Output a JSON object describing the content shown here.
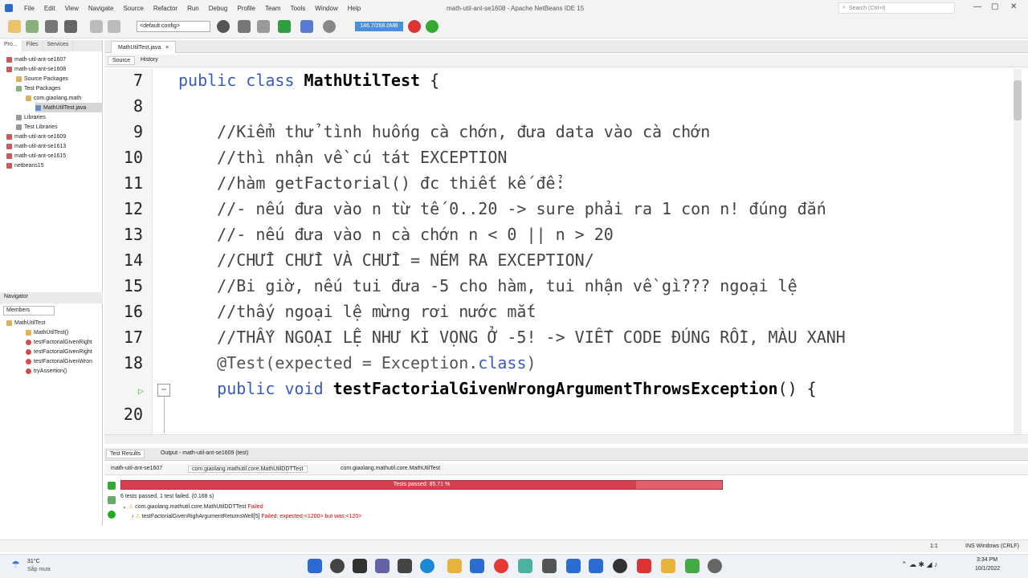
{
  "window_title": "math-util-ant-se1608 - Apache NetBeans IDE 15",
  "menu": [
    "File",
    "Edit",
    "View",
    "Navigate",
    "Source",
    "Refactor",
    "Run",
    "Debug",
    "Profile",
    "Team",
    "Tools",
    "Window",
    "Help"
  ],
  "search_placeholder": "Search (Ctrl+I)",
  "toolbar": {
    "config": "<default config>",
    "memory": "146.7/268.0MB"
  },
  "left_panel": {
    "tabs": [
      "Pro...",
      "Files",
      "Services"
    ],
    "tree": [
      "math-util-ant-se1607",
      "math-util-ant-se1608",
      "Source Packages",
      "Test Packages",
      "com.giaolang.math",
      "MathUtilTest.java",
      "Libraries",
      "Test Libraries",
      "math-util-ant-se1609",
      "math-util-ant-se1613",
      "math-util-ant-se1615",
      "netbeans15"
    ]
  },
  "navigator": {
    "title": "Navigator",
    "filter": "Members",
    "root": "MathUtilTest",
    "members": [
      "MathUtilTest()",
      "testFactorialGivenRight",
      "testFactorialGivenRight",
      "testFactorialGivenWron",
      "tryAssertion()"
    ]
  },
  "editor": {
    "tab": "MathUtilTest.java",
    "subtabs": [
      "Source",
      "History"
    ],
    "lines": [
      {
        "no": "7",
        "parts": [
          [
            "kw2",
            "public class "
          ],
          [
            "cls",
            "MathUtilTest"
          ],
          [
            "",
            " {"
          ]
        ]
      },
      {
        "no": "8",
        "parts": []
      },
      {
        "no": "9",
        "parts": [
          [
            "cmt",
            "    //Kiểm thử tình huống cà chớn, đưa data vào cà chớn"
          ]
        ]
      },
      {
        "no": "10",
        "parts": [
          [
            "cmt",
            "    //thì nhận về cú tát EXCEPTION"
          ]
        ]
      },
      {
        "no": "11",
        "parts": [
          [
            "cmt",
            "    //hàm getFactorial() đc thiết kế để:"
          ]
        ]
      },
      {
        "no": "12",
        "parts": [
          [
            "cmt",
            "    //- nếu đưa vào n từ tế 0..20 -> sure phải ra 1 con n! đúng đắn"
          ]
        ]
      },
      {
        "no": "13",
        "parts": [
          [
            "cmt",
            "    //- nếu đưa vào n cà chớn n < 0 || n > 20"
          ]
        ]
      },
      {
        "no": "14",
        "parts": [
          [
            "cmt",
            "    //CHỬI CHỬI VÀ CHỬI = NÉM RA EXCEPTION/"
          ]
        ]
      },
      {
        "no": "15",
        "parts": [
          [
            "cmt",
            "    //Bi giờ, nếu tui đưa -5 cho hàm, tui nhận về gì??? ngoại lệ"
          ]
        ]
      },
      {
        "no": "16",
        "parts": [
          [
            "cmt",
            "    //thấy ngoại lệ mừng rơi nước mắt"
          ]
        ]
      },
      {
        "no": "17",
        "parts": [
          [
            "cmt",
            "    //THẤY NGOẠI LỆ NHƯ KÌ VỌNG Ở -5! -> VIẾT CODE ĐÚNG RỒI, MÀU XANH"
          ]
        ]
      },
      {
        "no": "18",
        "parts": [
          [
            "ann",
            "    @Test(expected = Exception."
          ],
          [
            "kw2",
            "class"
          ],
          [
            "ann",
            ")"
          ]
        ]
      },
      {
        "no": "",
        "parts": [
          [
            "kw2",
            "    public void "
          ],
          [
            "cls",
            "testFactorialGivenWrongArgumentThrowsException"
          ],
          [
            "",
            "() {"
          ]
        ]
      },
      {
        "no": "20",
        "parts": []
      }
    ]
  },
  "bottom": {
    "tabs": [
      "Test Results",
      "Output - math-util-ant-se1609 (test)"
    ],
    "result_tabs": [
      "math-util-ant-se1607",
      "com.giaolang.mathutil.core.MathUtilDDTTest",
      "com.giaolang.mathutil.core.MathUtilTest"
    ],
    "progress_label": "Tests passed: 85.71 %",
    "progress_value": 0.8571,
    "summary": "6 tests passed, 1 test failed. (0.168 s)",
    "suite": "com.giaolang.mathutil.core.MathUtilDDTTest",
    "suite_status": "Failed",
    "test": "testFactorialGivenRighArgumentReturnsWell[5]",
    "test_status": "Failed: expected:<1200> but was:<120>"
  },
  "status_bar": {
    "position": "1:1",
    "mode": "INS Windows (CRLF)"
  },
  "taskbar": {
    "weather_temp": "31°C",
    "weather_desc": "Sắp mưa",
    "time": "3:34 PM",
    "date": "10/1/2022"
  }
}
